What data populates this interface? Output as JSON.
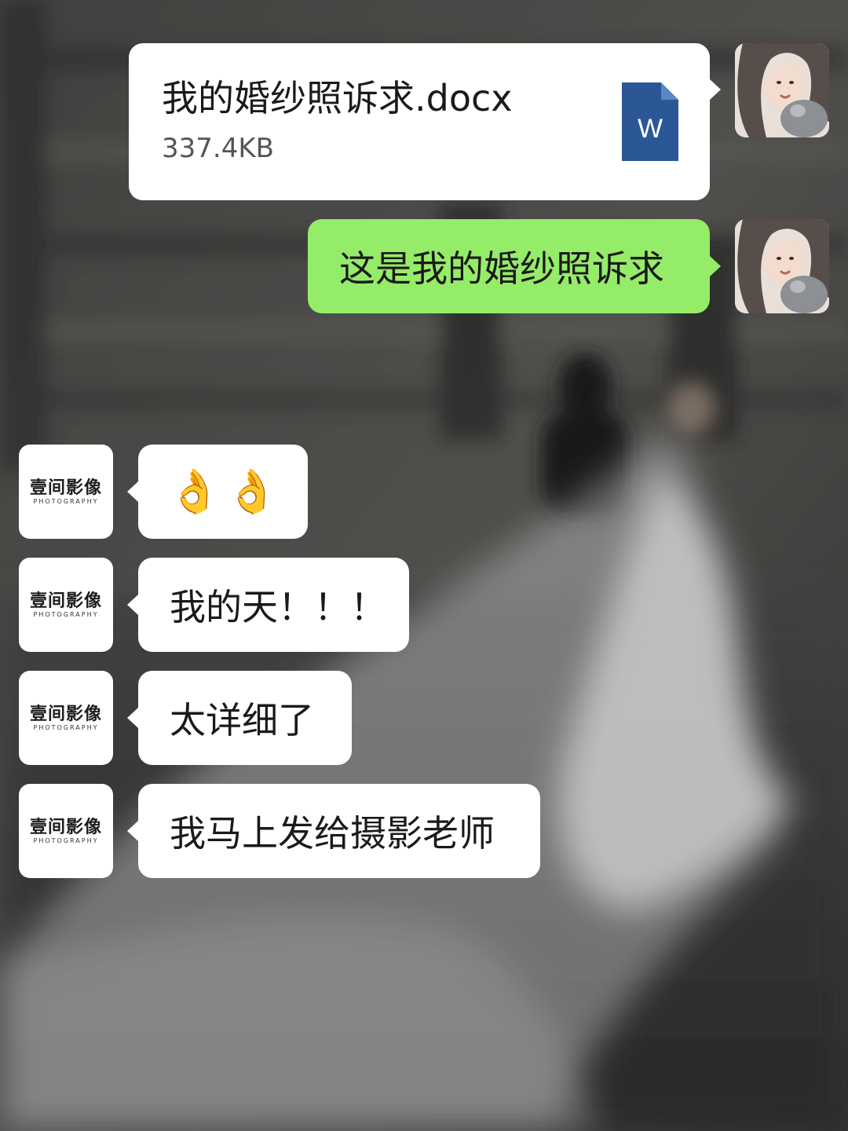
{
  "theme": {
    "bubble_white": "#ffffff",
    "bubble_green": "#95ec69",
    "doc_icon_blue": "#2b5797"
  },
  "messages": [
    {
      "side": "right",
      "kind": "file",
      "file_name": "我的婚纱照诉求.docx",
      "file_size": "337.4KB",
      "file_icon": "word-doc-icon",
      "file_icon_letter": "W"
    },
    {
      "side": "right",
      "kind": "text",
      "text": "这是我的婚纱照诉求"
    },
    {
      "side": "left",
      "kind": "emoji",
      "text": "👌👌"
    },
    {
      "side": "left",
      "kind": "text",
      "text": "我的天！！！"
    },
    {
      "side": "left",
      "kind": "text",
      "text": "太详细了"
    },
    {
      "side": "left",
      "kind": "text",
      "text": "我马上发给摄影老师"
    }
  ],
  "studio_avatar": {
    "name_cn": "壹间影像",
    "name_en": "PHOTOGRAPHY"
  }
}
